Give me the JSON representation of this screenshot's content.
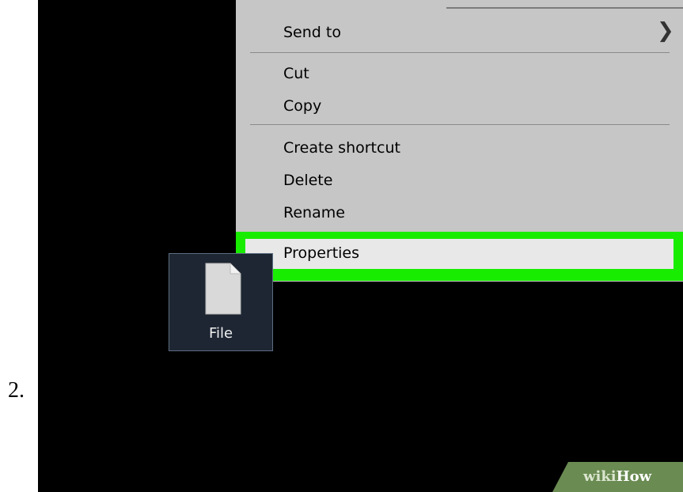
{
  "step": {
    "number": "2."
  },
  "context_menu": {
    "items": [
      {
        "label": "Send to",
        "has_submenu": true
      },
      {
        "label": "Cut"
      },
      {
        "label": "Copy"
      },
      {
        "label": "Create shortcut"
      },
      {
        "label": "Delete"
      },
      {
        "label": "Rename"
      },
      {
        "label": "Properties",
        "highlighted": true
      }
    ]
  },
  "desktop": {
    "file_label": "File"
  },
  "watermark": {
    "wiki": "wiki",
    "how": "How"
  },
  "colors": {
    "menu_background": "#c6c6c6",
    "highlight_green": "#18ec00",
    "desktop_background": "#000000",
    "file_selection": "#1d2632"
  },
  "icons": {
    "submenu": "chevron-right-icon",
    "file": "file-icon"
  }
}
